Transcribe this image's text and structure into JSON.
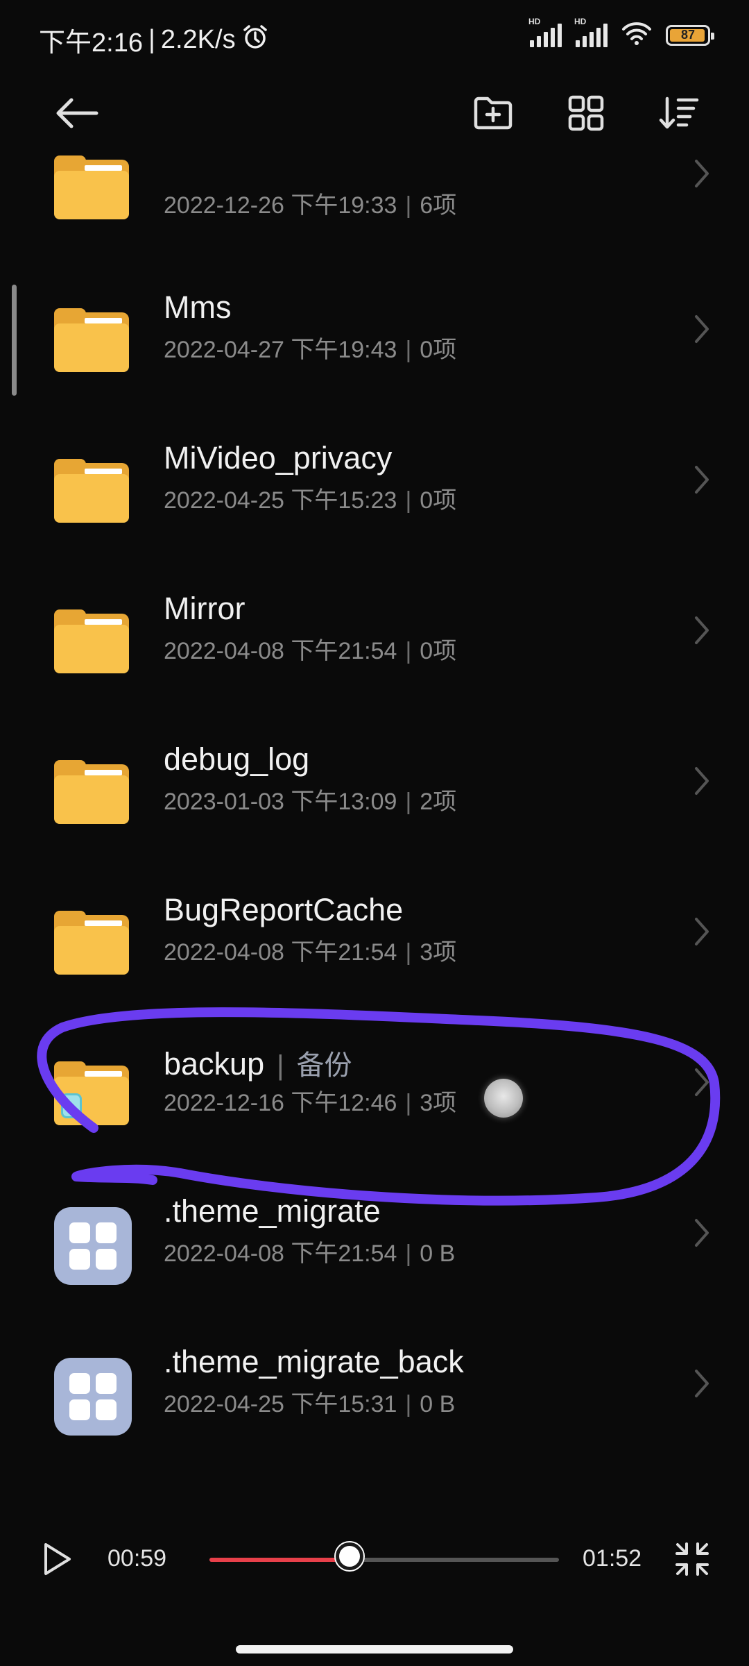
{
  "status_bar": {
    "time": "下午2:16",
    "net_speed": "2.2K/s",
    "separator": "|",
    "sim1_label": "HD",
    "sim2_label": "HD",
    "battery": "87"
  },
  "toolbar": {
    "back_icon": "arrow-left-icon",
    "new_folder_icon": "new-folder-icon",
    "grid_view_icon": "grid-view-icon",
    "sort_icon": "sort-icon"
  },
  "files": [
    {
      "name": "",
      "date": "2022-12-26 下午19:33",
      "count": "6项",
      "type": "folder"
    },
    {
      "name": "Mms",
      "date": "2022-04-27 下午19:43",
      "count": "0项",
      "type": "folder"
    },
    {
      "name": "MiVideo_privacy",
      "date": "2022-04-25 下午15:23",
      "count": "0项",
      "type": "folder"
    },
    {
      "name": "Mirror",
      "date": "2022-04-08 下午21:54",
      "count": "0项",
      "type": "folder"
    },
    {
      "name": "debug_log",
      "date": "2023-01-03 下午13:09",
      "count": "2项",
      "type": "folder"
    },
    {
      "name": "BugReportCache",
      "date": "2022-04-08 下午21:54",
      "count": "3项",
      "type": "folder"
    },
    {
      "name": "backup",
      "tag": "备份",
      "date": "2022-12-16 下午12:46",
      "count": "3项",
      "type": "folder"
    },
    {
      "name": ".theme_migrate",
      "date": "2022-04-08 下午21:54",
      "count": "0 B",
      "type": "file"
    },
    {
      "name": ".theme_migrate_back",
      "date": "2022-04-25 下午15:31",
      "count": "0 B",
      "type": "file"
    }
  ],
  "meta_separator": "|",
  "tag_separator": "|",
  "player": {
    "current_time": "00:59",
    "total_time": "01:52",
    "progress": 0.4
  },
  "colors": {
    "folder": "#F9C24B",
    "highlight_stroke": "#6A3CF0",
    "progress": "#E8404A"
  }
}
